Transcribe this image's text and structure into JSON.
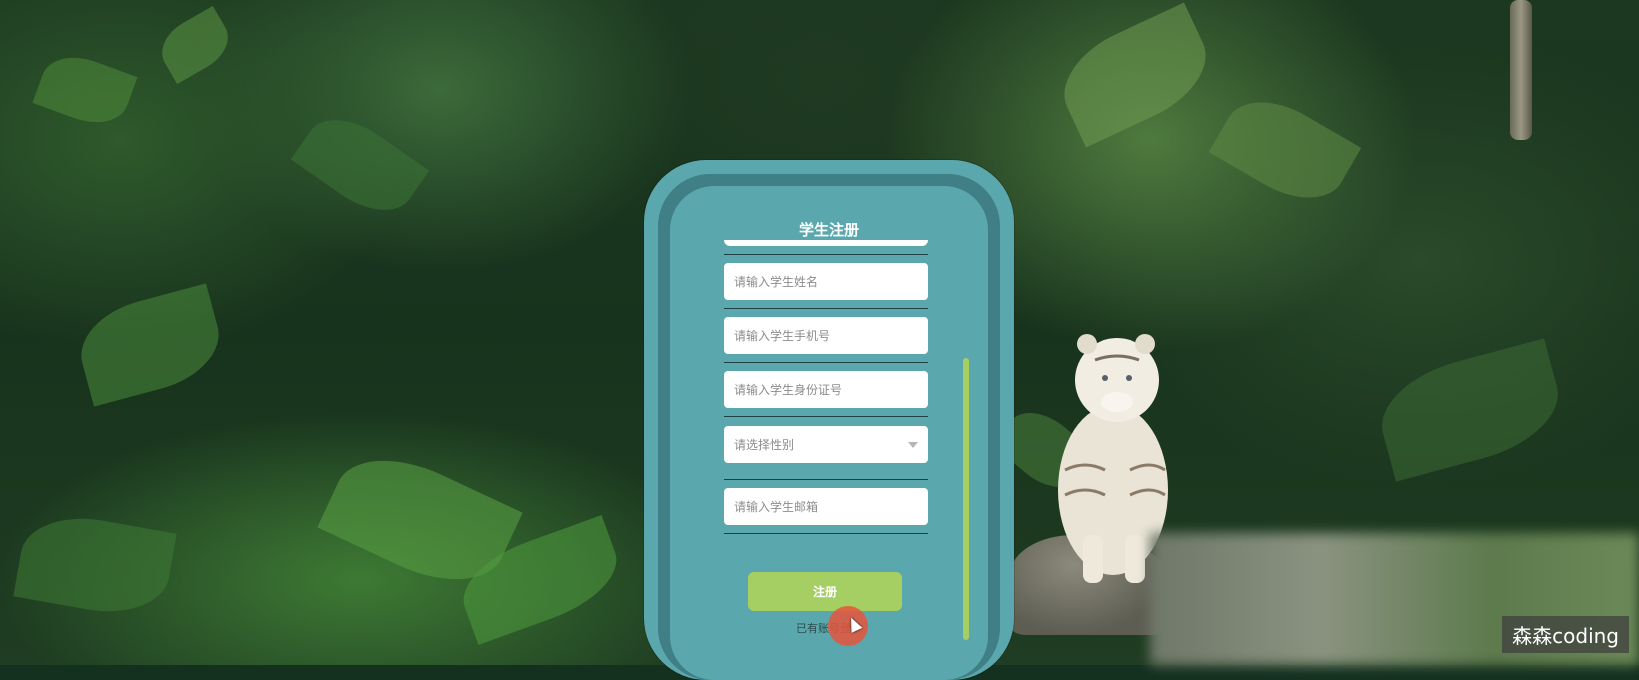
{
  "form": {
    "title": "学生注册",
    "fields": [
      {
        "name": "student-name",
        "placeholder": "请输入学生姓名"
      },
      {
        "name": "student-phone",
        "placeholder": "请输入学生手机号"
      },
      {
        "name": "student-id-card",
        "placeholder": "请输入学生身份证号"
      },
      {
        "name": "gender-select",
        "placeholder": "请选择性别"
      },
      {
        "name": "student-email",
        "placeholder": "请输入学生邮箱"
      }
    ],
    "submit_label": "注册",
    "login_link": "已有账号登录"
  },
  "watermark": "森森coding",
  "colors": {
    "card": "#5aa8ad",
    "card_ring": "#3f7f85",
    "accent": "#a6cf63"
  }
}
